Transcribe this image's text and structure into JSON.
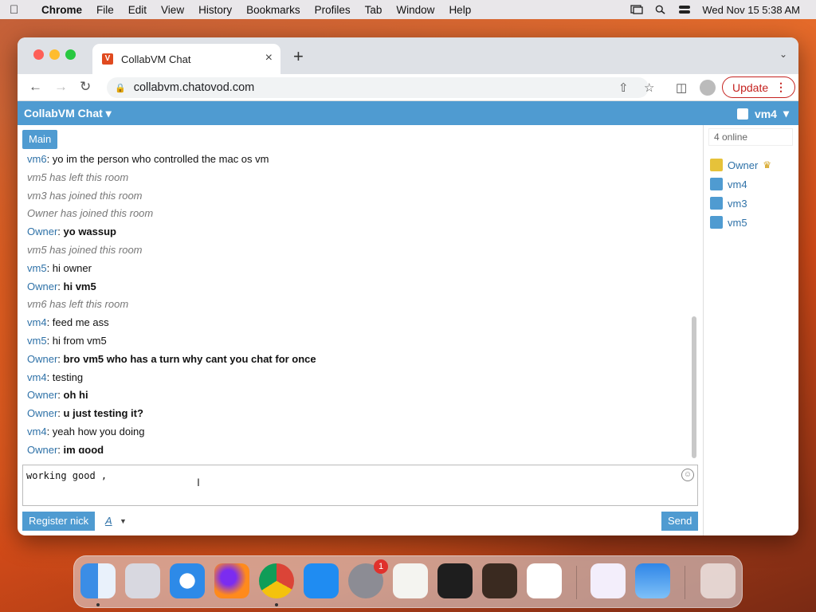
{
  "menubar": {
    "app": "Chrome",
    "items": [
      "File",
      "Edit",
      "View",
      "History",
      "Bookmarks",
      "Profiles",
      "Tab",
      "Window",
      "Help"
    ],
    "datetime": "Wed Nov 15  5:38 AM"
  },
  "browser": {
    "tab_title": "CollabVM Chat",
    "url": "collabvm.chatovod.com",
    "update_label": "Update"
  },
  "app": {
    "brand": "CollabVM Chat",
    "current_user": "vm4",
    "room_tab": "Main",
    "online_count": "4 online",
    "users": [
      {
        "name": "Owner",
        "role": "owner"
      },
      {
        "name": "vm4",
        "role": "user"
      },
      {
        "name": "vm3",
        "role": "user"
      },
      {
        "name": "vm5",
        "role": "user"
      }
    ],
    "messages": [
      {
        "nick": "vm6",
        "text": "yo im the person who controlled the mac os vm",
        "bold": false
      },
      {
        "system": "vm5 has left this room"
      },
      {
        "system": "vm3 has joined this room"
      },
      {
        "system": "Owner has joined this room"
      },
      {
        "nick": "Owner",
        "text": "yo wassup",
        "bold": true
      },
      {
        "system": "vm5 has joined this room"
      },
      {
        "nick": "vm5",
        "text": "hi owner",
        "bold": false
      },
      {
        "nick": "Owner",
        "text": "hi vm5",
        "bold": true
      },
      {
        "system": "vm6 has left this room"
      },
      {
        "nick": "vm4",
        "text": "feed me ass",
        "bold": false
      },
      {
        "nick": "vm5",
        "text": "hi from vm5",
        "bold": false
      },
      {
        "nick": "Owner",
        "text": "bro vm5 who has a turn why cant you chat for once",
        "bold": true
      },
      {
        "nick": "vm4",
        "text": "testing",
        "bold": false
      },
      {
        "nick": "Owner",
        "text": "oh hi",
        "bold": true
      },
      {
        "nick": "Owner",
        "text": "u just testing it?",
        "bold": true
      },
      {
        "nick": "vm4",
        "text": "yeah how you doing",
        "bold": false
      },
      {
        "nick": "Owner",
        "text": "im good",
        "bold": true
      }
    ],
    "input_value": "working good ,",
    "register_label": "Register nick",
    "font_label": "A",
    "send_label": "Send"
  },
  "dock": {
    "apps": [
      "finder-icon",
      "launchpad-icon",
      "safari-icon",
      "firefox-icon",
      "chrome-icon",
      "app-store-icon",
      "system-settings-icon",
      "textedit-icon",
      "terminal-icon",
      "garageband-icon",
      "vscode-icon",
      "visual-studio-icon",
      "weather-icon",
      "trash-icon"
    ],
    "settings_badge": "1"
  }
}
